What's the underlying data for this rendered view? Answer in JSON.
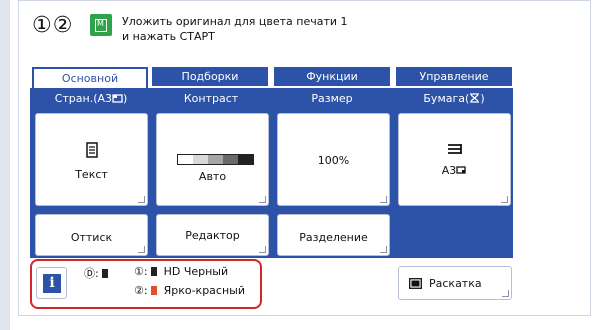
{
  "status": {
    "circled_numbers": "①②",
    "message_line1": "Уложить оригинал для цвета печати 1",
    "message_line2": "и нажать СТАРТ"
  },
  "tabs": [
    {
      "label": "Основной",
      "active": true
    },
    {
      "label": "Подборки",
      "active": false
    },
    {
      "label": "Функции",
      "active": false
    },
    {
      "label": "Управление",
      "active": false
    }
  ],
  "headers": {
    "page": "Стран.(A3",
    "contrast": "Контраст",
    "size": "Размер",
    "paper": "Бумага("
  },
  "tiles": {
    "mode_label": "Текст",
    "contrast_label": "Авто",
    "contrast_level": 3,
    "contrast_steps": 5,
    "size_label": "100%",
    "paper_label": "A3"
  },
  "functions": {
    "print": "Оттиск",
    "editor": "Редактор",
    "separation": "Разделение"
  },
  "ink": {
    "drum_symbol": "Ⓓ:",
    "color1_num": "①:",
    "color1_name": "HD Черный",
    "color1_hex": "#222222",
    "color2_num": "②:",
    "color2_name": "Ярко-красный",
    "color2_hex": "#e2502b"
  },
  "raskatka_label": "Раскатка",
  "colors": {
    "accent": "#2d53a8",
    "message_icon": "#2ea34a",
    "highlight": "#d0272b"
  }
}
